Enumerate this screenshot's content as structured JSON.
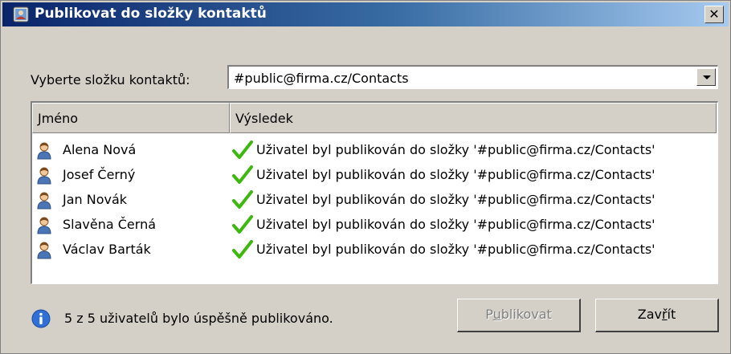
{
  "window": {
    "title": "Publikovat do složky kontaktů",
    "close_glyph": "✕",
    "icon": "address-book-icon"
  },
  "folder": {
    "label": "Vyberte složku kontaktů:",
    "value": "#public@firma.cz/Contacts"
  },
  "table": {
    "columns": [
      "Jméno",
      "Výsledek"
    ],
    "rows": [
      {
        "name": "Alena Nová",
        "result": "Uživatel byl publikován do složky '#public@firma.cz/Contacts'"
      },
      {
        "name": "Josef Černý",
        "result": "Uživatel byl publikován do složky '#public@firma.cz/Contacts'"
      },
      {
        "name": "Jan Novák",
        "result": "Uživatel byl publikován do složky '#public@firma.cz/Contacts'"
      },
      {
        "name": "Slavěna Černá",
        "result": "Uživatel byl publikován do složky '#public@firma.cz/Contacts'"
      },
      {
        "name": "Václav Barták",
        "result": "Uživatel byl publikován do složky '#public@firma.cz/Contacts'"
      }
    ]
  },
  "status": {
    "icon": "info-icon",
    "text": "5 z 5 uživatelů bylo úspěšně publikováno."
  },
  "buttons": {
    "publish_pre": "P",
    "publish_ul": "u",
    "publish_post": "blikovat",
    "publish_state": "disabled",
    "close_pre": "Zav",
    "close_ul": "ř",
    "close_post": "ít"
  },
  "colors": {
    "title_start": "#0a246a",
    "title_end": "#a6caf0",
    "check_green": "#3cb80f",
    "info_blue": "#2f6fd6",
    "dialog_bg": "#d4d0c8"
  }
}
